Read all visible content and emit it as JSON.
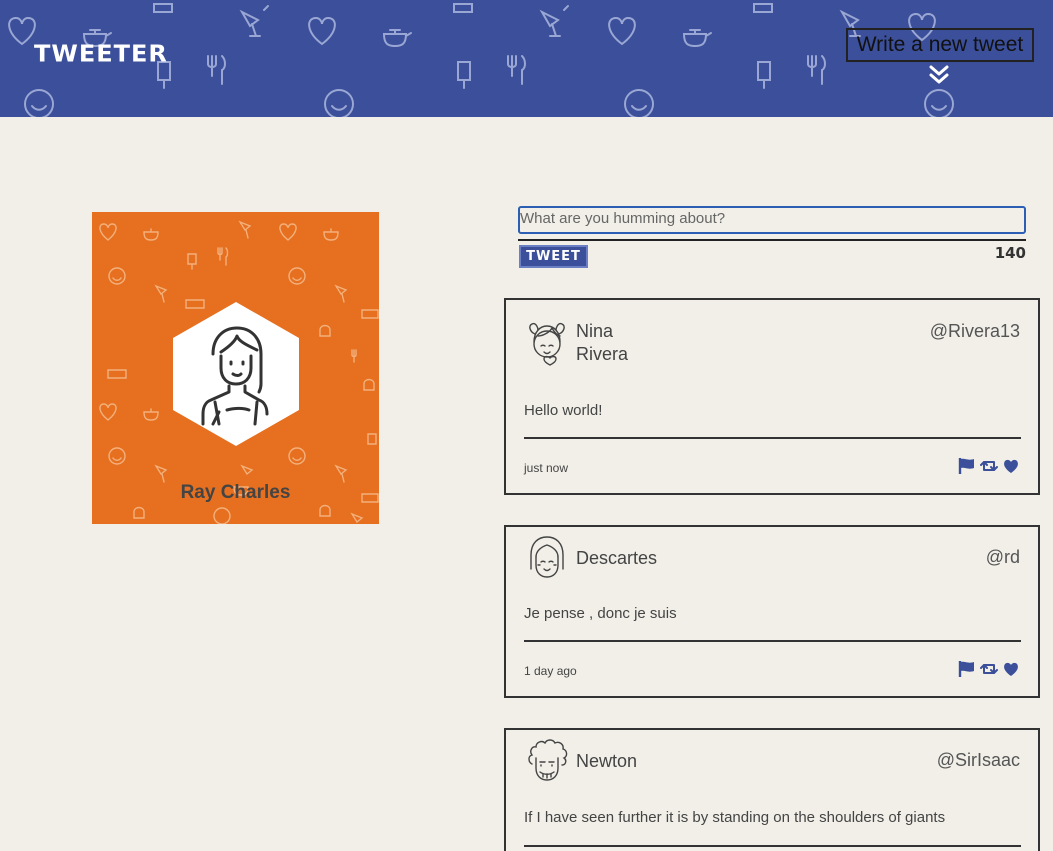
{
  "nav": {
    "brand": "Tweeter",
    "compose_toggle": "Write a new tweet",
    "toggle_icon": "double-chevron-down-icon"
  },
  "profile": {
    "name": "Ray Charles",
    "background_color": "#e6701f",
    "avatar_icon": "woman-avatar-icon"
  },
  "composer": {
    "placeholder": "What are you humming about?",
    "value": "",
    "button_label": "Tweet",
    "counter": "140"
  },
  "tweets": [
    {
      "name_line1": "Nina",
      "name_line2": "Rivera",
      "handle": "@Rivera13",
      "text": "Hello world!",
      "time": "just now",
      "avatar_icon": "girl-avatar-icon"
    },
    {
      "name_line1": "Descartes",
      "name_line2": "",
      "handle": "@rd",
      "text": "Je pense , donc je suis",
      "time": "1 day ago",
      "avatar_icon": "bob-haircut-avatar-icon"
    },
    {
      "name_line1": "Newton",
      "name_line2": "",
      "handle": "@SirIsaac",
      "text": "If I have seen further it is by standing on the shoulders of giants",
      "time": "",
      "avatar_icon": "curly-hair-avatar-icon"
    }
  ],
  "actions": [
    "flag-icon",
    "retweet-icon",
    "heart-icon"
  ],
  "colors": {
    "nav_blue": "#3b4f9a",
    "page_bg": "#f1efe8",
    "profile_orange": "#e6701f",
    "input_focus": "#2c5fb3"
  }
}
